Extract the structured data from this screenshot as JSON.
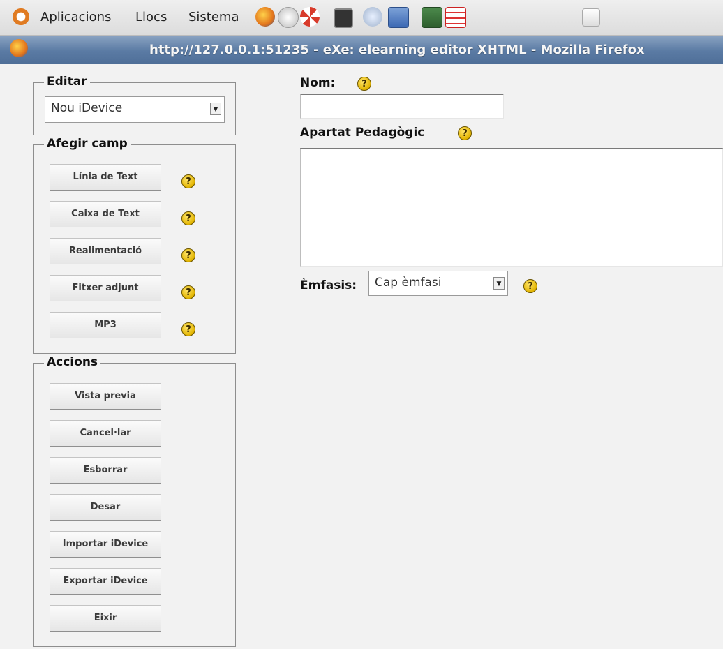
{
  "panel": {
    "menus": [
      "Aplicacions",
      "Llocs",
      "Sistema"
    ]
  },
  "window": {
    "title": "http://127.0.0.1:51235 - eXe: elearning editor XHTML - Mozilla Firefox"
  },
  "sidebar": {
    "editar": {
      "legend": "Editar",
      "select_value": "Nou iDevice"
    },
    "afegir_camp": {
      "legend": "Afegir camp",
      "buttons": [
        "Línia de Text",
        "Caixa de Text",
        "Realimentació",
        "Fitxer adjunt",
        "MP3"
      ]
    },
    "accions": {
      "legend": "Accions",
      "buttons": [
        "Vista previa",
        "Cancel·lar",
        "Esborrar",
        "Desar",
        "Importar iDevice",
        "Exportar iDevice",
        "Eixir"
      ]
    }
  },
  "form": {
    "nom_label": "Nom:",
    "nom_value": "",
    "apartat_label": "Apartat Pedagògic",
    "apartat_value": "",
    "emfasis_label": "Èmfasis:",
    "emfasis_value": "Cap èmfasi"
  },
  "help_glyph": "?",
  "select_arrow_glyph": "▼",
  "colors": {
    "titlebar": "#5b7ba4",
    "help_icon": "#e2b400"
  }
}
